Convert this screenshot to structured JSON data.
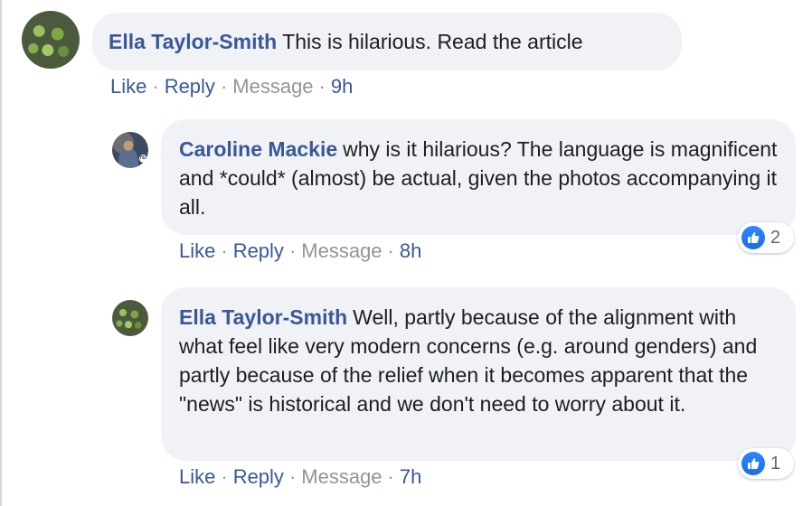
{
  "comments": [
    {
      "author": "Ella Taylor-Smith",
      "text": "This is hilarious. Read the article",
      "actions": {
        "like": "Like",
        "reply": "Reply",
        "message": "Message",
        "time": "9h"
      },
      "avatar_icon": "leaf-photo-avatar"
    },
    {
      "author": "Caroline Mackie",
      "text": "why is it hilarious? The language is magnificent and *could* (almost) be actual, given the photos accompanying it all.",
      "actions": {
        "like": "Like",
        "reply": "Reply",
        "message": "Message",
        "time": "8h"
      },
      "reaction": {
        "icon": "like-thumb-icon",
        "count": "2"
      },
      "avatar_icon": "person-photo-avatar"
    },
    {
      "author": "Ella Taylor-Smith",
      "text": "Well, partly because of the alignment with what feel like very modern concerns (e.g. around genders) and partly because of the relief when it becomes apparent that the \"news\" is historical and we don't need to worry about it.",
      "actions": {
        "like": "Like",
        "reply": "Reply",
        "message": "Message",
        "time": "7h"
      },
      "reaction": {
        "icon": "like-thumb-icon",
        "count": "1"
      },
      "avatar_icon": "leaf-photo-avatar"
    }
  ],
  "colors": {
    "author": "#385898",
    "link": "#385898",
    "muted": "#90949c",
    "bubble": "#f0f2f5",
    "like_blue": "#2d88ff"
  }
}
